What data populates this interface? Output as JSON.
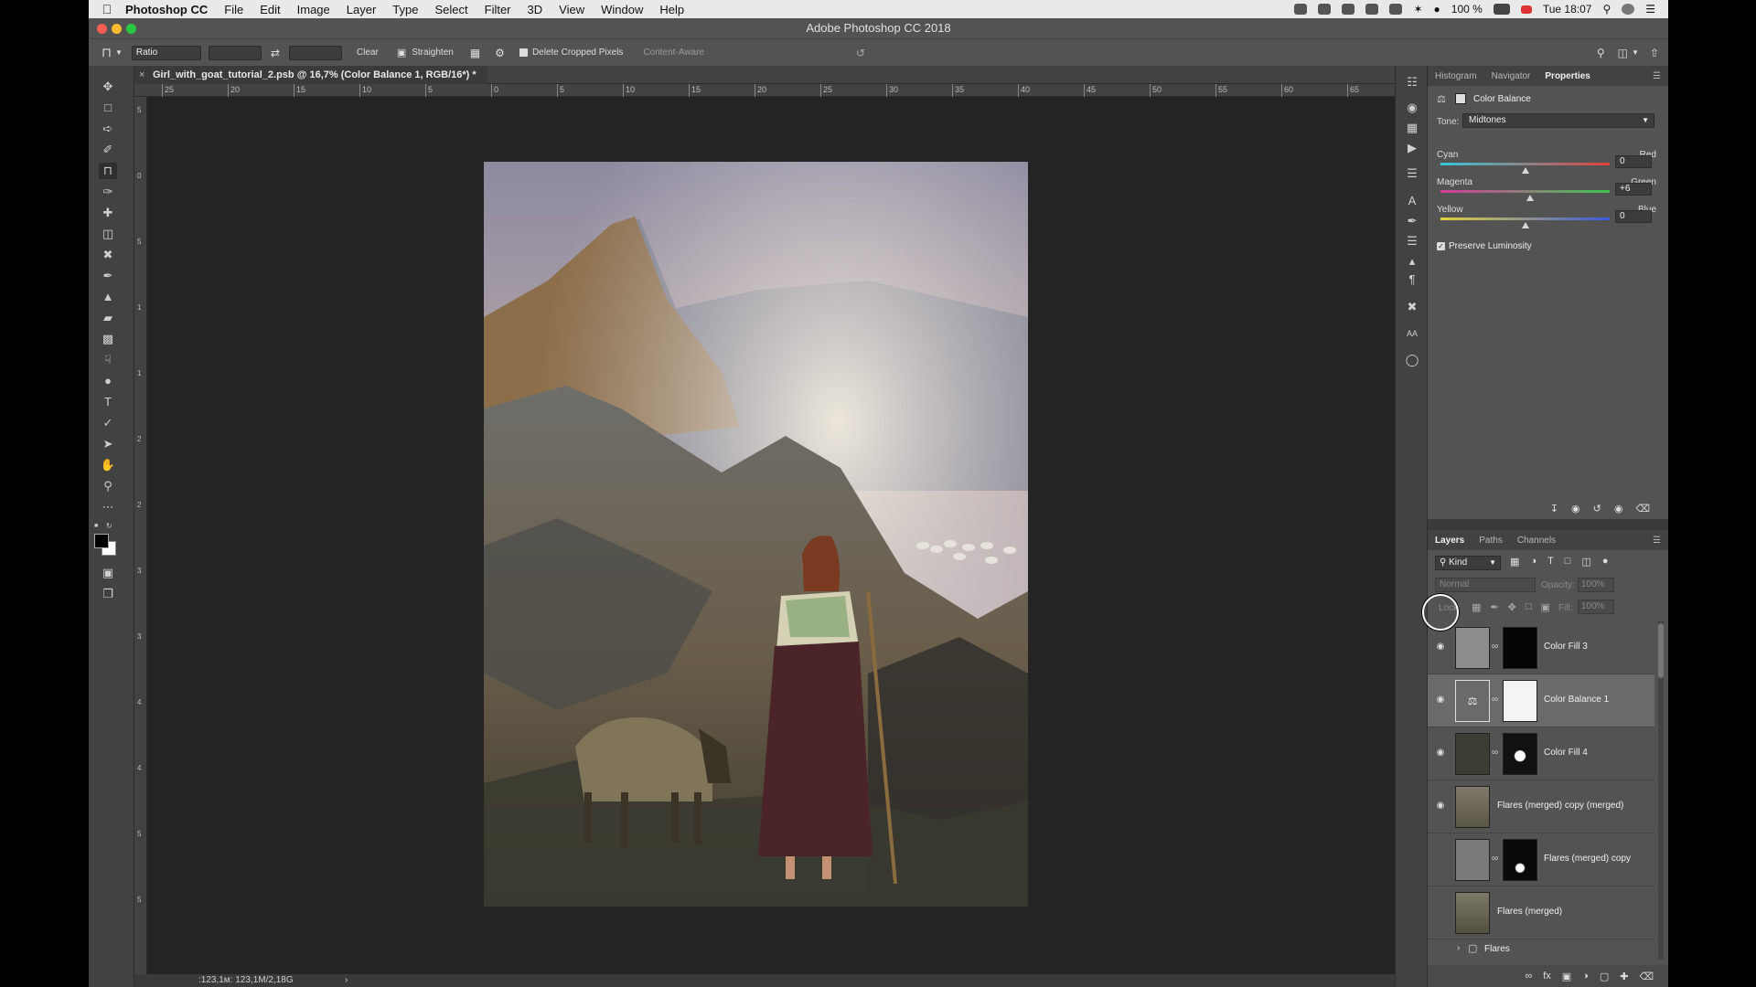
{
  "menubar": {
    "app_name": "Photoshop CC",
    "items": [
      "File",
      "Edit",
      "Image",
      "Layer",
      "Type",
      "Select",
      "Filter",
      "3D",
      "View",
      "Window",
      "Help"
    ],
    "battery": "100 %",
    "clock": "Tue 18:07"
  },
  "window": {
    "title": "Adobe Photoshop CC 2018"
  },
  "options_bar": {
    "ratio_label": "Ratio",
    "clear_label": "Clear",
    "straighten_label": "Straighten",
    "delete_cropped_label": "Delete Cropped Pixels",
    "delete_cropped_checked": true,
    "content_aware_label": "Content-Aware"
  },
  "document": {
    "tab_title": "Girl_with_goat_tutorial_2.psb @ 16,7% (Color Balance 1, RGB/16*) *",
    "status": ":123,1м: 123,1M/2,18G"
  },
  "ruler": {
    "top_ticks": [
      "25",
      "20",
      "15",
      "10",
      "5",
      "0",
      "5",
      "10",
      "15",
      "20",
      "25",
      "30",
      "35",
      "40",
      "45",
      "50",
      "55",
      "60",
      "65"
    ],
    "left_ticks": [
      "5",
      "0",
      "5",
      "1",
      "1",
      "2",
      "2",
      "3",
      "3",
      "4",
      "4",
      "5",
      "5"
    ]
  },
  "properties_panel": {
    "tabs": [
      "Histogram",
      "Navigator",
      "Properties"
    ],
    "active_tab": "Properties",
    "header": "Color Balance",
    "tone_label": "Tone:",
    "tone_value": "Midtones",
    "sliders": [
      {
        "left": "Cyan",
        "right": "Red",
        "value": "0",
        "position": 0.5
      },
      {
        "left": "Magenta",
        "right": "Green",
        "value": "+6",
        "position": 0.53
      },
      {
        "left": "Yellow",
        "right": "Blue",
        "value": "0",
        "position": 0.5
      }
    ],
    "preserve_luminosity_label": "Preserve Luminosity",
    "preserve_luminosity_checked": true
  },
  "layers_panel": {
    "tabs": [
      "Layers",
      "Paths",
      "Channels"
    ],
    "active_tab": "Layers",
    "kind_label": "Kind",
    "blend_mode": "Normal",
    "opacity_label": "Opacity:",
    "opacity_value": "100%",
    "lock_label": "Lock:",
    "fill_label": "Fill:",
    "fill_value": "100%",
    "layers": [
      {
        "name": "Color Fill 3",
        "visible": true,
        "selected": false
      },
      {
        "name": "Color Balance 1",
        "visible": true,
        "selected": true
      },
      {
        "name": "Color Fill 4",
        "visible": true,
        "selected": false
      },
      {
        "name": "Flares (merged) copy (merged)",
        "visible": true,
        "selected": false
      },
      {
        "name": "Flares (merged) copy",
        "visible": false,
        "selected": false
      },
      {
        "name": "Flares (merged)",
        "visible": false,
        "selected": false
      }
    ],
    "group_name": "Flares"
  },
  "colors": {
    "cyan": "#35c7d6",
    "red": "#e0413e",
    "magenta": "#d53c9a",
    "green": "#3ec452",
    "yellow": "#e2d23a",
    "blue": "#3b58e0"
  }
}
